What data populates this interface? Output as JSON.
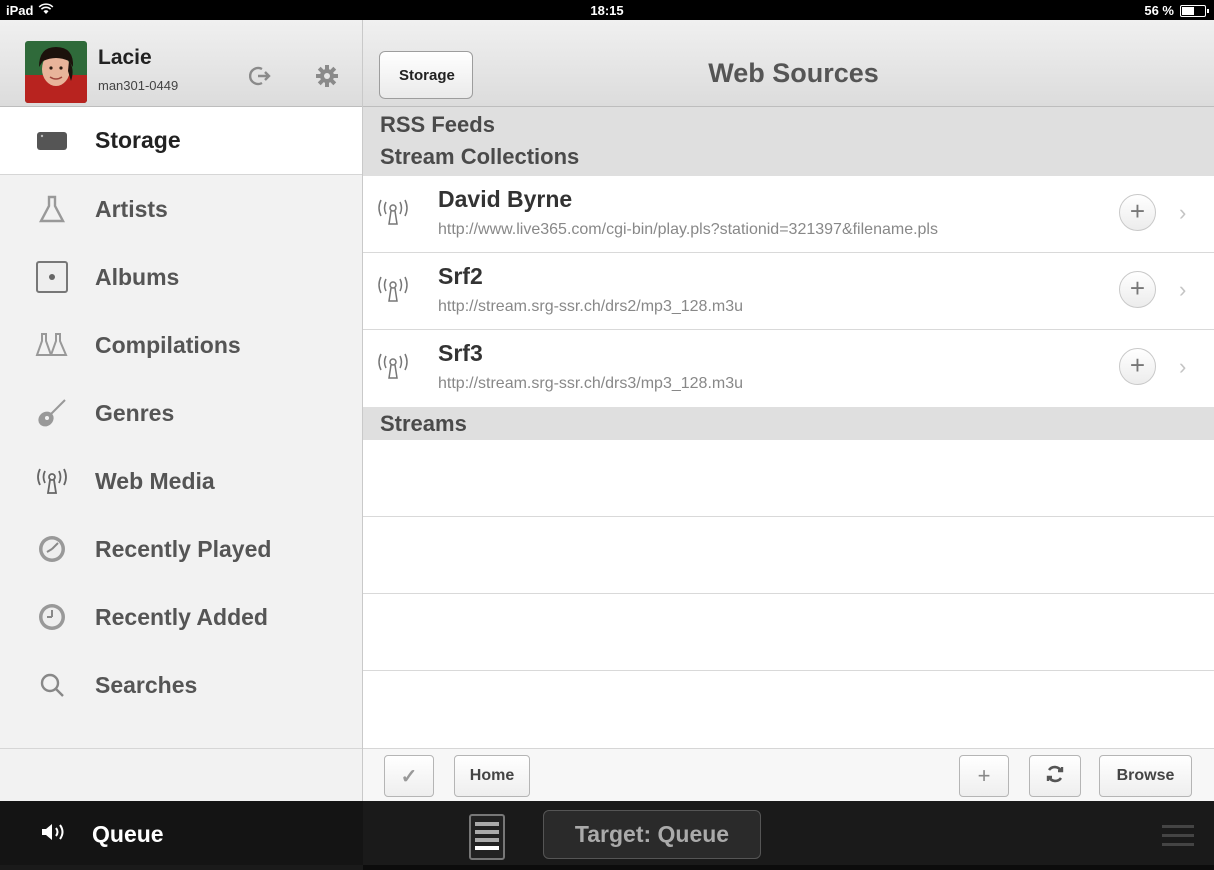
{
  "status_bar": {
    "device": "iPad",
    "time": "18:15",
    "battery": "56 %",
    "battery_level": 0.56
  },
  "profile": {
    "name": "Lacie",
    "subtitle": "man301-0449",
    "logout_icon": "logout-icon",
    "settings_icon": "gear-icon"
  },
  "sidebar": {
    "items": [
      {
        "label": "Storage",
        "icon": "storage-icon"
      },
      {
        "label": "Artists",
        "icon": "artist-icon"
      },
      {
        "label": "Albums",
        "icon": "album-icon"
      },
      {
        "label": "Compilations",
        "icon": "compilations-icon"
      },
      {
        "label": "Genres",
        "icon": "guitar-icon"
      },
      {
        "label": "Web Media",
        "icon": "antenna-icon"
      },
      {
        "label": "Recently Played",
        "icon": "clock-icon"
      },
      {
        "label": "Recently Added",
        "icon": "clock-icon"
      },
      {
        "label": "Searches",
        "icon": "search-icon"
      }
    ]
  },
  "nav": {
    "back_label": "Storage",
    "title": "Web Sources"
  },
  "sections": {
    "rss": "RSS Feeds",
    "stream_collections": "Stream Collections",
    "streams": "Streams"
  },
  "stream_collections": [
    {
      "title": "David Byrne",
      "url": "http://www.live365.com/cgi-bin/play.pls?stationid=321397&filename.pls"
    },
    {
      "title": "Srf2",
      "url": "http://stream.srg-ssr.ch/drs2/mp3_128.m3u"
    },
    {
      "title": "Srf3",
      "url": "http://stream.srg-ssr.ch/drs3/mp3_128.m3u"
    }
  ],
  "toolbar": {
    "check": "✓",
    "home": "Home",
    "add": "+",
    "refresh_icon": "refresh-icon",
    "browse": "Browse"
  },
  "bottom": {
    "queue_label": "Queue",
    "target_label": "Target: Queue"
  },
  "colors": {
    "header_gradient_top": "#f0f0f0",
    "header_gradient_bottom": "#dcdcdc",
    "section_bg": "#dfdfdf",
    "bottom_bar": "#1a1a1a"
  }
}
